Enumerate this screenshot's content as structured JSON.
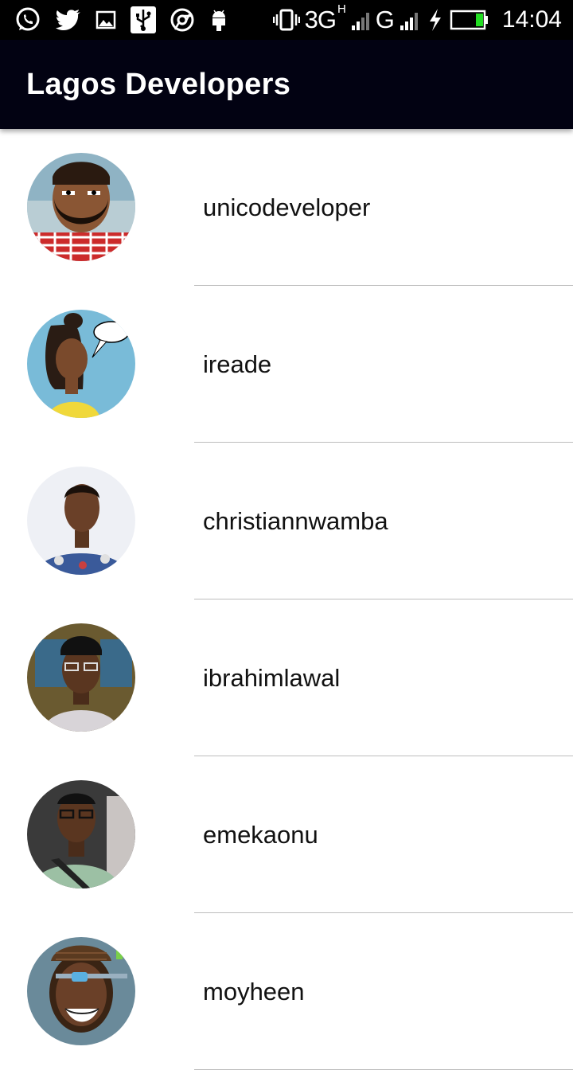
{
  "status_bar": {
    "left_icons": [
      "whatsapp-icon",
      "twitter-icon",
      "image-icon",
      "usb-icon",
      "chrome-icon",
      "android-icon"
    ],
    "network_label": "3G",
    "network_sub": "H",
    "network_label_2": "G",
    "time": "14:04",
    "battery_color": "#22dd22"
  },
  "app_bar": {
    "title": "Lagos Developers",
    "color": "#020212"
  },
  "developers": [
    {
      "username": "unicodeveloper"
    },
    {
      "username": "ireade"
    },
    {
      "username": "christiannwamba"
    },
    {
      "username": "ibrahimlawal"
    },
    {
      "username": "emekaonu"
    },
    {
      "username": "moyheen"
    }
  ]
}
